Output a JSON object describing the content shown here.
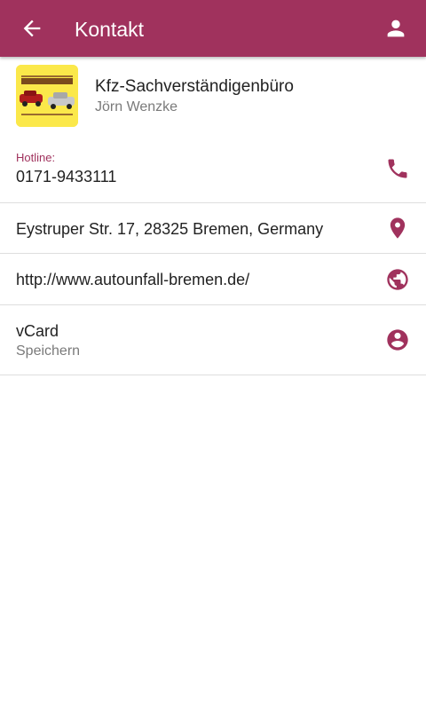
{
  "colors": {
    "accent": "#a0325d",
    "logo_background": "#fbe84a"
  },
  "app_bar": {
    "back_icon": "arrow-left-icon",
    "title": "Kontakt",
    "profile_icon": "account-icon"
  },
  "header": {
    "logo_text_line1": "KFZ-SACHVERSTÄNDIGENBÜRO",
    "logo_text_line2": "JÖRN WENZKE",
    "company": "Kfz-Sachverständigenbüro",
    "person": "Jörn Wenzke"
  },
  "rows": [
    {
      "label": "Hotline:",
      "value": "0171-9433111",
      "icon": "phone-icon"
    },
    {
      "value": "Eystruper Str. 17, 28325 Bremen, Germany",
      "icon": "location-pin-icon"
    },
    {
      "value": "http://www.autounfall-bremen.de/",
      "icon": "globe-icon"
    },
    {
      "value": "vCard",
      "sub": "Speichern",
      "icon": "account-circle-icon"
    }
  ]
}
